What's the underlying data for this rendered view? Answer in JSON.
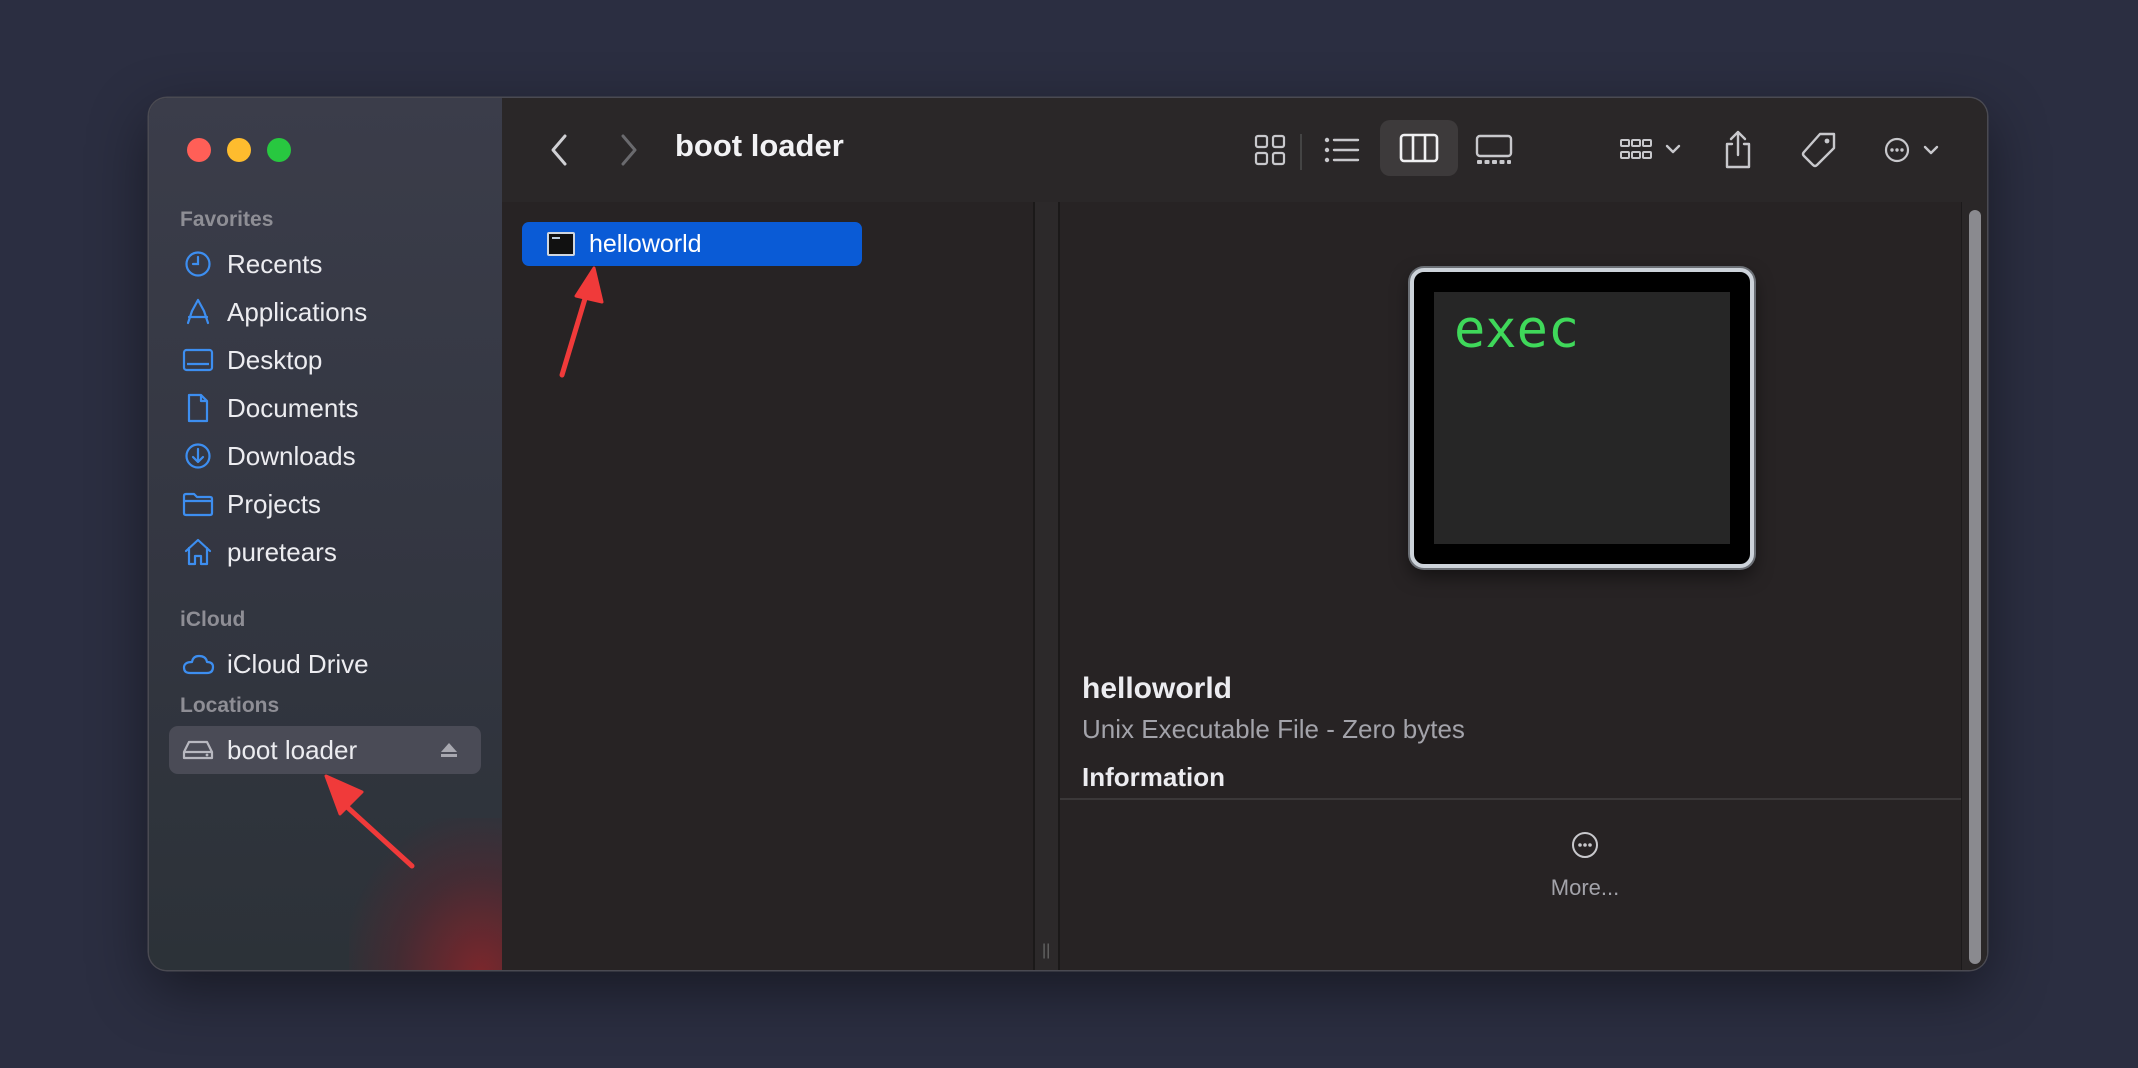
{
  "window": {
    "title": "boot loader"
  },
  "sidebar": {
    "sections": [
      {
        "title": "Favorites",
        "items": [
          {
            "label": "Recents",
            "icon": "clock-icon"
          },
          {
            "label": "Applications",
            "icon": "applications-icon"
          },
          {
            "label": "Desktop",
            "icon": "desktop-icon"
          },
          {
            "label": "Documents",
            "icon": "document-icon"
          },
          {
            "label": "Downloads",
            "icon": "download-icon"
          },
          {
            "label": "Projects",
            "icon": "folder-icon"
          },
          {
            "label": "puretears",
            "icon": "home-icon"
          }
        ]
      },
      {
        "title": "iCloud",
        "items": [
          {
            "label": "iCloud Drive",
            "icon": "cloud-icon"
          }
        ]
      },
      {
        "title": "Locations",
        "items": [
          {
            "label": "boot loader",
            "icon": "drive-icon",
            "selected": true
          }
        ]
      }
    ]
  },
  "toolbar": {
    "icons": [
      "back-icon",
      "forward-icon",
      "icon-view-icon",
      "list-view-icon",
      "column-view-icon",
      "gallery-view-icon",
      "group-icon",
      "share-icon",
      "tag-icon",
      "more-actions-icon",
      "search-icon"
    ],
    "selected_view": "column-view-icon"
  },
  "column": {
    "files": [
      {
        "name": "helloworld",
        "selected": true
      }
    ]
  },
  "preview": {
    "icon_text": "exec",
    "name": "helloworld",
    "kind": "Unix Executable File - Zero bytes",
    "section": "Information",
    "more_label": "More..."
  },
  "colors": {
    "accent": "#0a5bd6",
    "annotation": "#f03a3a",
    "exec_text": "#3fd85a"
  }
}
